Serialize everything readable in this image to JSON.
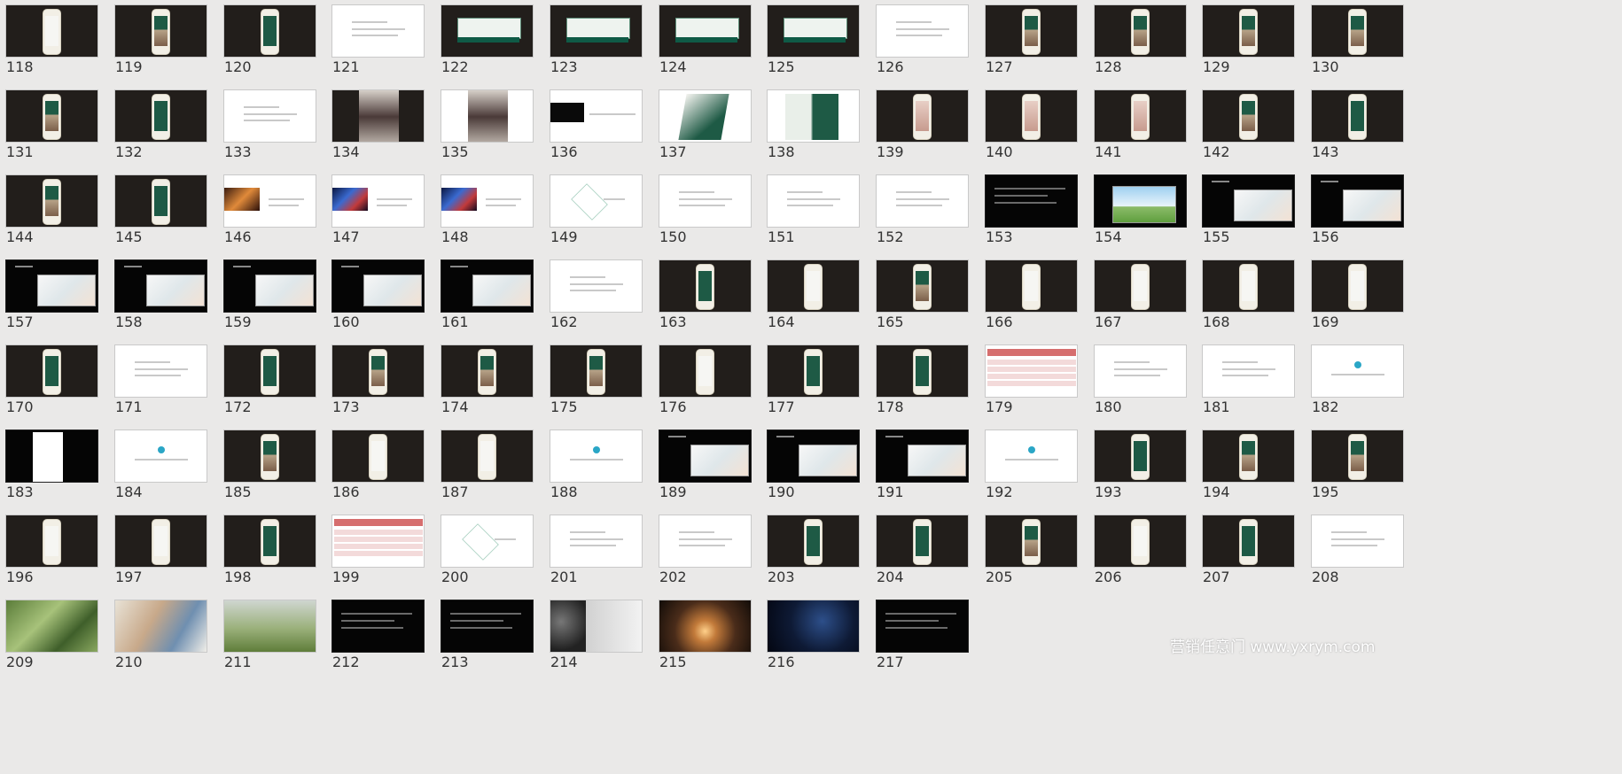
{
  "slides": [
    {
      "n": "118",
      "style": "phone",
      "screen": "white"
    },
    {
      "n": "119",
      "style": "phone",
      "screen": "photo"
    },
    {
      "n": "120",
      "style": "phone",
      "screen": "green"
    },
    {
      "n": "121",
      "style": "text"
    },
    {
      "n": "122",
      "style": "panel"
    },
    {
      "n": "123",
      "style": "panel"
    },
    {
      "n": "124",
      "style": "panel"
    },
    {
      "n": "125",
      "style": "panel"
    },
    {
      "n": "126",
      "style": "text"
    },
    {
      "n": "127",
      "style": "phone",
      "screen": "photo"
    },
    {
      "n": "128",
      "style": "phone",
      "screen": "photo"
    },
    {
      "n": "129",
      "style": "phone",
      "screen": "photo"
    },
    {
      "n": "130",
      "style": "phone",
      "screen": "photo"
    },
    {
      "n": "131",
      "style": "phone",
      "screen": "photo"
    },
    {
      "n": "132",
      "style": "phone",
      "screen": "green"
    },
    {
      "n": "133",
      "style": "text"
    },
    {
      "n": "134",
      "style": "tall"
    },
    {
      "n": "135",
      "style": "tall-white"
    },
    {
      "n": "136",
      "style": "leftimg-sm"
    },
    {
      "n": "137",
      "style": "card"
    },
    {
      "n": "138",
      "style": "cards2"
    },
    {
      "n": "139",
      "style": "phone",
      "screen": "pink"
    },
    {
      "n": "140",
      "style": "phone",
      "screen": "pink"
    },
    {
      "n": "141",
      "style": "phone",
      "screen": "pink"
    },
    {
      "n": "142",
      "style": "phone",
      "screen": "photo"
    },
    {
      "n": "143",
      "style": "phone",
      "screen": "green"
    },
    {
      "n": "144",
      "style": "phone",
      "screen": "photo"
    },
    {
      "n": "145",
      "style": "phone",
      "screen": "green"
    },
    {
      "n": "146",
      "style": "leftimg"
    },
    {
      "n": "147",
      "style": "leftimg-blue"
    },
    {
      "n": "148",
      "style": "leftimg-blue"
    },
    {
      "n": "149",
      "style": "diagram"
    },
    {
      "n": "150",
      "style": "text"
    },
    {
      "n": "151",
      "style": "text"
    },
    {
      "n": "152",
      "style": "text"
    },
    {
      "n": "153",
      "style": "black-text"
    },
    {
      "n": "154",
      "style": "illus-sky"
    },
    {
      "n": "155",
      "style": "illus"
    },
    {
      "n": "156",
      "style": "illus"
    },
    {
      "n": "157",
      "style": "illus"
    },
    {
      "n": "158",
      "style": "illus"
    },
    {
      "n": "159",
      "style": "illus"
    },
    {
      "n": "160",
      "style": "illus"
    },
    {
      "n": "161",
      "style": "illus"
    },
    {
      "n": "162",
      "style": "text"
    },
    {
      "n": "163",
      "style": "phone",
      "screen": "green"
    },
    {
      "n": "164",
      "style": "phone",
      "screen": "white"
    },
    {
      "n": "165",
      "style": "phone",
      "screen": "photo"
    },
    {
      "n": "166",
      "style": "phone",
      "screen": "white"
    },
    {
      "n": "167",
      "style": "phone",
      "screen": "white"
    },
    {
      "n": "168",
      "style": "phone",
      "screen": "white"
    },
    {
      "n": "169",
      "style": "phone",
      "screen": "white"
    },
    {
      "n": "170",
      "style": "phone",
      "screen": "green"
    },
    {
      "n": "171",
      "style": "text"
    },
    {
      "n": "172",
      "style": "phone",
      "screen": "green"
    },
    {
      "n": "173",
      "style": "phone",
      "screen": "photo"
    },
    {
      "n": "174",
      "style": "phone",
      "screen": "photo"
    },
    {
      "n": "175",
      "style": "phone",
      "screen": "photo"
    },
    {
      "n": "176",
      "style": "phone",
      "screen": "white"
    },
    {
      "n": "177",
      "style": "phone",
      "screen": "green"
    },
    {
      "n": "178",
      "style": "phone",
      "screen": "green"
    },
    {
      "n": "179",
      "style": "table"
    },
    {
      "n": "180",
      "style": "text"
    },
    {
      "n": "181",
      "style": "text"
    },
    {
      "n": "182",
      "style": "dot"
    },
    {
      "n": "183",
      "style": "doc"
    },
    {
      "n": "184",
      "style": "dot"
    },
    {
      "n": "185",
      "style": "phone",
      "screen": "photo"
    },
    {
      "n": "186",
      "style": "phone",
      "screen": "white"
    },
    {
      "n": "187",
      "style": "phone",
      "screen": "white"
    },
    {
      "n": "188",
      "style": "dot"
    },
    {
      "n": "189",
      "style": "illus"
    },
    {
      "n": "190",
      "style": "illus"
    },
    {
      "n": "191",
      "style": "illus"
    },
    {
      "n": "192",
      "style": "dot"
    },
    {
      "n": "193",
      "style": "phone",
      "screen": "green"
    },
    {
      "n": "194",
      "style": "phone",
      "screen": "photo"
    },
    {
      "n": "195",
      "style": "phone",
      "screen": "photo"
    },
    {
      "n": "196",
      "style": "phone",
      "screen": "white"
    },
    {
      "n": "197",
      "style": "phone",
      "screen": "white"
    },
    {
      "n": "198",
      "style": "phone",
      "screen": "green"
    },
    {
      "n": "199",
      "style": "table"
    },
    {
      "n": "200",
      "style": "diagram"
    },
    {
      "n": "201",
      "style": "text"
    },
    {
      "n": "202",
      "style": "text"
    },
    {
      "n": "203",
      "style": "phone",
      "screen": "green"
    },
    {
      "n": "204",
      "style": "phone",
      "screen": "green"
    },
    {
      "n": "205",
      "style": "phone",
      "screen": "photo"
    },
    {
      "n": "206",
      "style": "phone",
      "screen": "white"
    },
    {
      "n": "207",
      "style": "phone",
      "screen": "green"
    },
    {
      "n": "208",
      "style": "text"
    },
    {
      "n": "209",
      "style": "photo-green"
    },
    {
      "n": "210",
      "style": "photo-family"
    },
    {
      "n": "211",
      "style": "photo-field"
    },
    {
      "n": "212",
      "style": "black-text"
    },
    {
      "n": "213",
      "style": "black-text"
    },
    {
      "n": "214",
      "style": "photo-bw"
    },
    {
      "n": "215",
      "style": "photo-sunset"
    },
    {
      "n": "216",
      "style": "photo-space"
    },
    {
      "n": "217",
      "style": "black-text"
    }
  ],
  "watermark": "营销任意门 www.yxrym.com"
}
